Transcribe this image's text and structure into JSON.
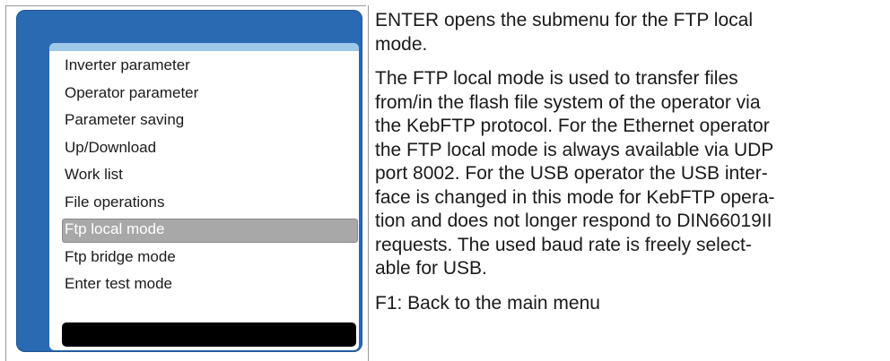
{
  "operator_screen": {
    "menu_items": [
      "Inverter parameter",
      "Operator parameter",
      "Parameter saving",
      "Up/Download",
      "Work list",
      "File operations",
      "Ftp local mode",
      "Ftp bridge mode",
      "Enter test mode"
    ],
    "selected_item": "Ftp local mode",
    "colors": {
      "frame": "#2a6ab3",
      "topbar": "#9ec8ea",
      "highlight": "#a8a8a8",
      "status_bar": "#000000"
    }
  },
  "description": {
    "intro": "ENTER opens the submenu for the FTP local\nmode.",
    "body": "The FTP local mode is used to transfer files\nfrom/in the flash file system of the operator via\nthe KebFTP protocol. For the Ethernet operator\nthe FTP local mode is always available via UDP\nport 8002. For the USB operator the USB inter-\nface is changed in this mode for KebFTP opera-\ntion and does not longer respond to DIN66019II\nrequests. The used baud rate is freely select-\nable for USB.",
    "f1_note": "F1: Back to the main menu"
  }
}
